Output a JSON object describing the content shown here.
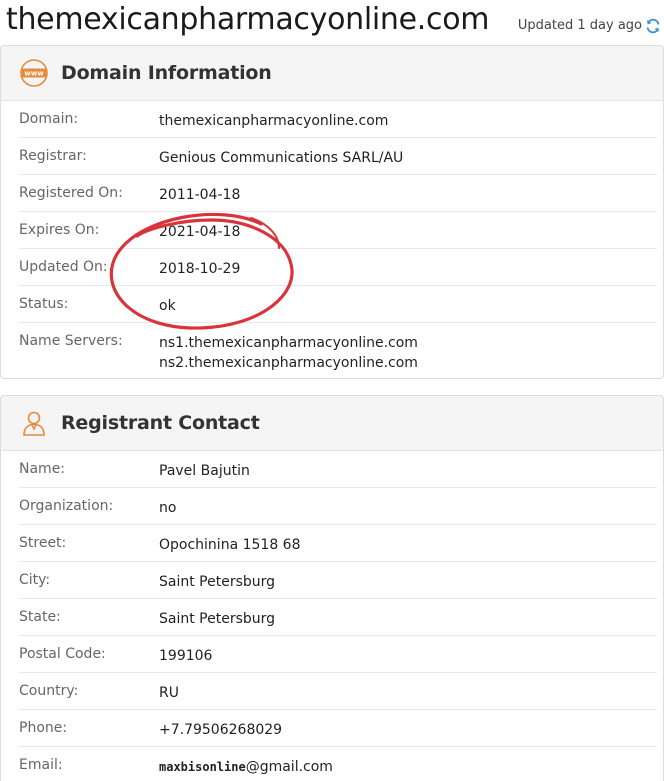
{
  "header": {
    "site_title": "themexicanpharmacyonline.com",
    "updated": "Updated 1 day ago"
  },
  "domain_panel": {
    "title": "Domain Information",
    "icon": "www-icon",
    "rows": [
      {
        "label": "Domain:",
        "value": "themexicanpharmacyonline.com"
      },
      {
        "label": "Registrar:",
        "value": "Genious Communications SARL/AU"
      },
      {
        "label": "Registered On:",
        "value": "2011-04-18"
      },
      {
        "label": "Expires On:",
        "value": "2021-04-18"
      },
      {
        "label": "Updated On:",
        "value": "2018-10-29"
      },
      {
        "label": "Status:",
        "value": "ok"
      },
      {
        "label": "Name Servers:",
        "value": "ns1.themexicanpharmacyonline.com",
        "value2": "ns2.themexicanpharmacyonline.com"
      }
    ]
  },
  "contact_panel": {
    "title": "Registrant Contact",
    "icon": "person-icon",
    "rows": [
      {
        "label": "Name:",
        "value": "Pavel Bajutin"
      },
      {
        "label": "Organization:",
        "value": "no"
      },
      {
        "label": "Street:",
        "value": "Opochinina 1518 68"
      },
      {
        "label": "City:",
        "value": "Saint Petersburg"
      },
      {
        "label": "State:",
        "value": "Saint Petersburg"
      },
      {
        "label": "Postal Code:",
        "value": "199106"
      },
      {
        "label": "Country:",
        "value": "RU"
      },
      {
        "label": "Phone:",
        "value": "+7.79506268029"
      },
      {
        "label": "Email:",
        "value_user": "maxbisonline",
        "value_domain": "@gmail.com"
      }
    ]
  },
  "colors": {
    "accent_orange": "#e8893a",
    "refresh_blue": "#3b8fd9",
    "annotation_red": "#d9343b"
  }
}
